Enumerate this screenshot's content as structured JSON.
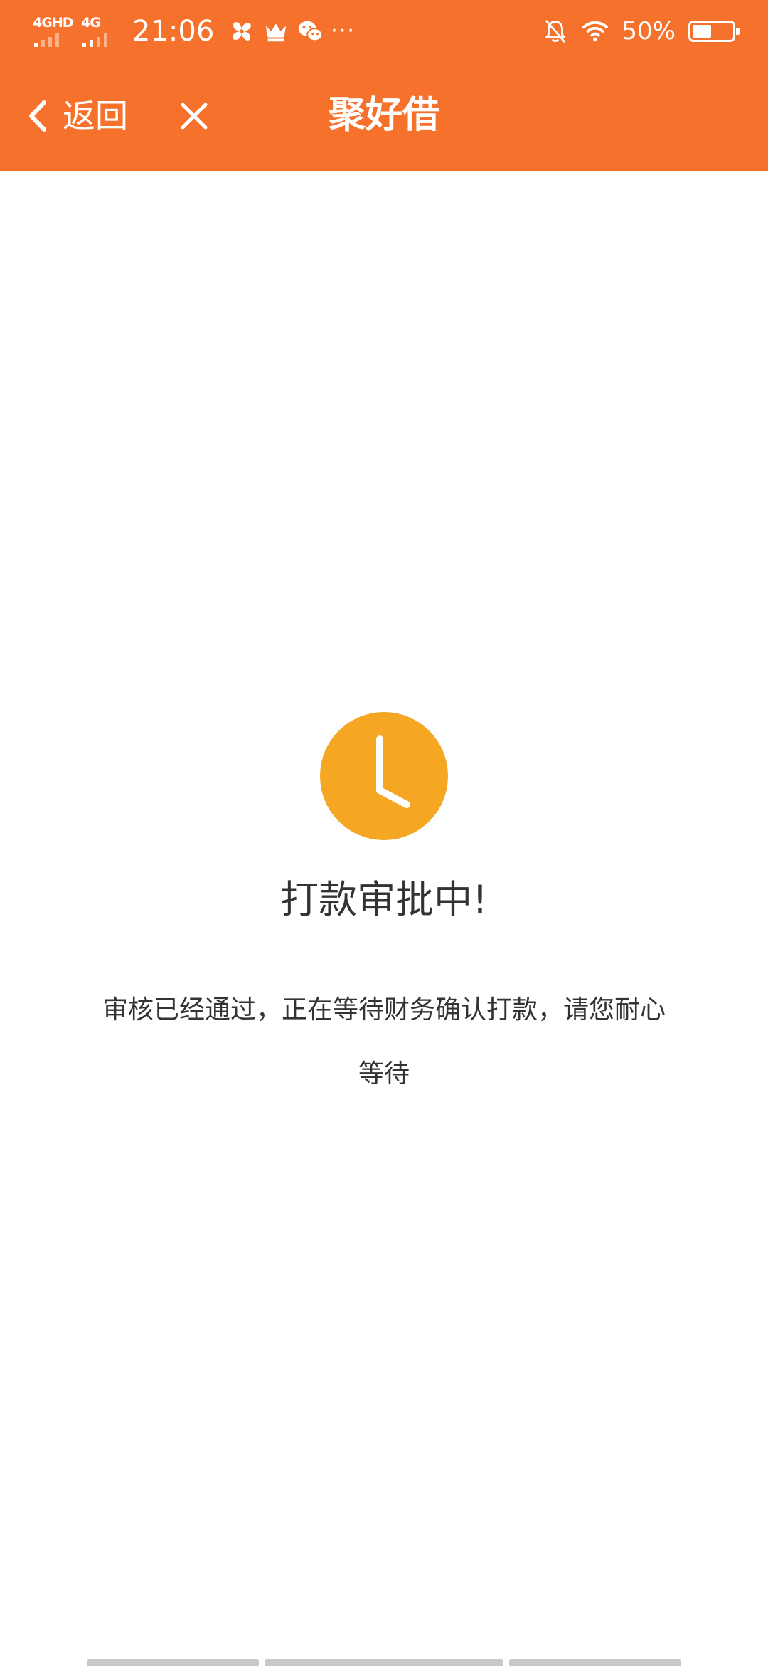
{
  "status_bar": {
    "network_1": "4GHD",
    "network_2": "4G",
    "time": "21:06",
    "icons": [
      "pinwheel-icon",
      "crown-icon",
      "wechat-icon"
    ],
    "more": "···",
    "silent_icon": "bell-off-icon",
    "wifi_icon": "wifi-icon",
    "battery_text": "50%",
    "battery_level": 0.5
  },
  "nav": {
    "back_label": "返回",
    "back_icon": "chevron-left-icon",
    "close_icon": "close-icon",
    "title": "聚好借"
  },
  "status": {
    "icon": "clock-icon",
    "title": "打款审批中!",
    "message_line_1": "审核已经通过，正在等待财务确认打款，请您耐心",
    "message_line_2": "等待"
  },
  "colors": {
    "header": "#F6712B",
    "clock": "#F5A623",
    "text": "#333333",
    "background": "#FFFFFF"
  }
}
